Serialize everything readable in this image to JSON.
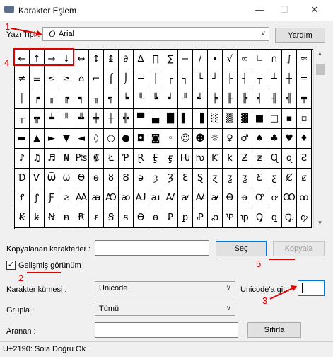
{
  "window": {
    "title": "Karakter Eşlem",
    "minimize_label": "—",
    "maximize_label": "☐",
    "close_label": "✕"
  },
  "font": {
    "label": "Yazı Tipi :",
    "glyph": "O",
    "value": "Arial",
    "arrow": "∨"
  },
  "buttons": {
    "help": "Yardım",
    "select": "Seç",
    "copy": "Kopyala",
    "reset": "Sıfırla"
  },
  "grid": {
    "rows": [
      [
        "←",
        "↑",
        "→",
        "↓",
        "↔",
        "↕",
        "↨",
        "∂",
        "∆",
        "∏",
        "∑",
        "−",
        "∕",
        "∙",
        "√",
        "∞",
        "∟",
        "∩",
        "∫",
        "≈"
      ],
      [
        "≠",
        "≡",
        "≤",
        "≥",
        "⌂",
        "⌐",
        "⌠",
        "⌡",
        "─",
        "│",
        "┌",
        "┐",
        "└",
        "┘",
        "├",
        "┤",
        "┬",
        "┴",
        "┼",
        "═"
      ],
      [
        "║",
        "╒",
        "╓",
        "╔",
        "╕",
        "╖",
        "╗",
        "╘",
        "╙",
        "╚",
        "╛",
        "╜",
        "╝",
        "╞",
        "╟",
        "╠",
        "╡",
        "╢",
        "╣",
        "╤"
      ],
      [
        "╥",
        "╦",
        "╧",
        "╨",
        "╩",
        "╪",
        "╫",
        "╬",
        "▀",
        "▄",
        "█",
        "▌",
        "▐",
        "░",
        "▒",
        "▓",
        "■",
        "□",
        "▪",
        "▫"
      ],
      [
        "▬",
        "▲",
        "►",
        "▼",
        "◄",
        "◊",
        "○",
        "●",
        "◘",
        "◙",
        "◦",
        "☺",
        "☻",
        "☼",
        "♀",
        "♂",
        "♠",
        "♣",
        "♥",
        "♦"
      ],
      [
        "♪",
        "♫",
        "♬",
        "₦",
        "₧",
        "₡",
        "Ł",
        "Ƥ",
        "Ɽ",
        "Ӻ",
        "ӻ",
        "Ƕ",
        "ƕ",
        "Ƙ",
        "ƙ",
        "Ƶ",
        "ƶ",
        "Ɋ",
        "ɋ",
        "Ƨ"
      ],
      [
        "Ɗ",
        "Ѵ",
        "Ѿ",
        "ѿ",
        "Ѳ",
        "ѳ",
        "ȣ",
        "Ȣ",
        "ə",
        "ȝ",
        "Ȝ",
        "Ɛ",
        "Ȿ",
        "ɀ",
        "ƺ",
        "ƺ",
        "Ƹ",
        "ƹ",
        "Ȼ",
        "ȼ"
      ],
      [
        "Ꝭ",
        "ꝭ",
        "Ƒ",
        "ƨ",
        "Ꜳ",
        "ꜳ",
        "Ꜵ",
        "ꜵ",
        "Ꜷ",
        "ꜷ",
        "Ꜹ",
        "ꜹ",
        "Ꜻ",
        "ꜻ",
        "Ꝋ",
        "ꝋ",
        "Ꝍ",
        "ꝍ",
        "Ꝏ",
        "ꝏ"
      ],
      [
        "Ꞣ",
        "ꞣ",
        "Ꞥ",
        "ꞥ",
        "Ꞧ",
        "ꞧ",
        "Ꞩ",
        "ꞩ",
        "Ɵ",
        "ɵ",
        "Ꝑ",
        "ꝑ",
        "Ꝓ",
        "ꝓ",
        "Ꝕ",
        "ꝕ",
        "Ꝗ",
        "ꝗ",
        "Ꝙ",
        "ꝙ"
      ]
    ]
  },
  "scrollbar": {
    "up": "▲",
    "down": "▼"
  },
  "copy_section": {
    "label": "Kopyalanan karakterler :",
    "value": ""
  },
  "advanced": {
    "checked_mark": "✓",
    "label": "Gelişmiş görünüm"
  },
  "charset": {
    "label": "Karakter kümesi :",
    "value": "Unicode",
    "arrow": "∨"
  },
  "goto_unicode": {
    "label": "Unicode'a git :",
    "value": ""
  },
  "group": {
    "label": "Grupla :",
    "value": "Tümü",
    "arrow": "∨"
  },
  "search": {
    "label": "Aranan :",
    "value": ""
  },
  "status": {
    "text": "U+2190: Sola Doğru Ok"
  },
  "annotations": {
    "n1": "1",
    "n2": "2",
    "n3": "3",
    "n4": "4",
    "n5": "5",
    "color": "#e00000"
  }
}
